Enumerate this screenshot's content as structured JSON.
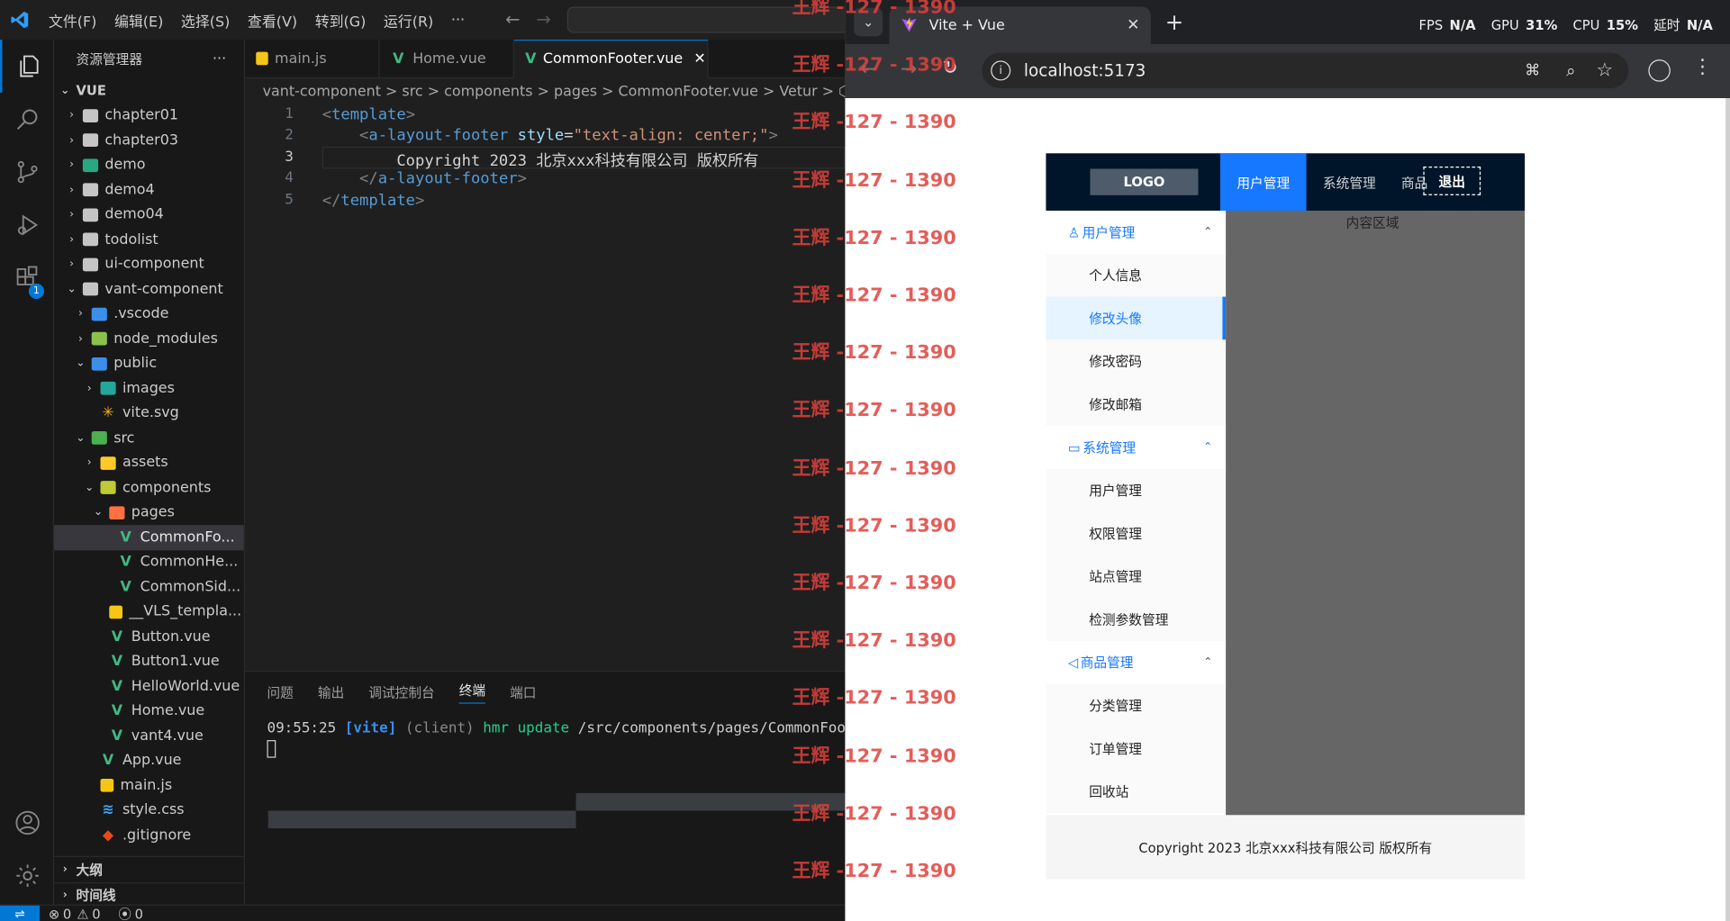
{
  "vscode": {
    "menu": [
      "文件(F)",
      "编辑(E)",
      "选择(S)",
      "查看(V)",
      "转到(G)",
      "运行(R)",
      "···"
    ],
    "explorer_title": "资源管理器",
    "explorer_more": "···",
    "root_label": "VUE",
    "tree": [
      {
        "label": "chapter01",
        "depth": 0,
        "chevron": "›",
        "icon": "folder"
      },
      {
        "label": "chapter03",
        "depth": 0,
        "chevron": "›",
        "icon": "folder"
      },
      {
        "label": "demo",
        "depth": 0,
        "chevron": "›",
        "icon": "folder-demo"
      },
      {
        "label": "demo4",
        "depth": 0,
        "chevron": "›",
        "icon": "folder"
      },
      {
        "label": "demo04",
        "depth": 0,
        "chevron": "›",
        "icon": "folder"
      },
      {
        "label": "todolist",
        "depth": 0,
        "chevron": "›",
        "icon": "folder"
      },
      {
        "label": "ui-component",
        "depth": 0,
        "chevron": "›",
        "icon": "folder"
      },
      {
        "label": "vant-component",
        "depth": 0,
        "chevron": "⌄",
        "icon": "folder-open"
      },
      {
        "label": ".vscode",
        "depth": 1,
        "chevron": "›",
        "icon": "folder-vscode"
      },
      {
        "label": "node_modules",
        "depth": 1,
        "chevron": "›",
        "icon": "folder-node"
      },
      {
        "label": "public",
        "depth": 1,
        "chevron": "⌄",
        "icon": "folder-public"
      },
      {
        "label": "images",
        "depth": 2,
        "chevron": "›",
        "icon": "folder-images"
      },
      {
        "label": "vite.svg",
        "depth": 2,
        "chevron": "",
        "icon": "svg-file"
      },
      {
        "label": "src",
        "depth": 1,
        "chevron": "⌄",
        "icon": "folder-src"
      },
      {
        "label": "assets",
        "depth": 2,
        "chevron": "›",
        "icon": "folder-assets"
      },
      {
        "label": "components",
        "depth": 2,
        "chevron": "⌄",
        "icon": "folder-components"
      },
      {
        "label": "pages",
        "depth": 3,
        "chevron": "⌄",
        "icon": "folder-pages"
      },
      {
        "label": "CommonFo...",
        "depth": 4,
        "chevron": "",
        "icon": "vue-file",
        "selected": true
      },
      {
        "label": "CommonHe...",
        "depth": 4,
        "chevron": "",
        "icon": "vue-file"
      },
      {
        "label": "CommonSid...",
        "depth": 4,
        "chevron": "",
        "icon": "vue-file"
      },
      {
        "label": "__VLS_templa...",
        "depth": 3,
        "chevron": "",
        "icon": "js-file"
      },
      {
        "label": "Button.vue",
        "depth": 3,
        "chevron": "",
        "icon": "vue-file"
      },
      {
        "label": "Button1.vue",
        "depth": 3,
        "chevron": "",
        "icon": "vue-file"
      },
      {
        "label": "HelloWorld.vue",
        "depth": 3,
        "chevron": "",
        "icon": "vue-file"
      },
      {
        "label": "Home.vue",
        "depth": 3,
        "chevron": "",
        "icon": "vue-file"
      },
      {
        "label": "vant4.vue",
        "depth": 3,
        "chevron": "",
        "icon": "vue-file"
      },
      {
        "label": "App.vue",
        "depth": 2,
        "chevron": "",
        "icon": "vue-file"
      },
      {
        "label": "main.js",
        "depth": 2,
        "chevron": "",
        "icon": "js-file"
      },
      {
        "label": "style.css",
        "depth": 2,
        "chevron": "",
        "icon": "css-file"
      },
      {
        "label": ".gitignore",
        "depth": 2,
        "chevron": "",
        "icon": "git-file"
      }
    ],
    "outline_label": "大纲",
    "timeline_label": "时间线",
    "tabs": [
      {
        "label": "main.js",
        "icon": "js-file"
      },
      {
        "label": "Home.vue",
        "icon": "vue-file"
      },
      {
        "label": "CommonFooter.vue",
        "icon": "vue-file",
        "active": true
      }
    ],
    "breadcrumb": "vant-component > src > components > pages > CommonFooter.vue > Vetur > ⬡ tem",
    "code_lines": [
      {
        "n": "1",
        "tokens": [
          {
            "t": "<",
            "c": "#808080"
          },
          {
            "t": "template",
            "c": "#569cd6"
          },
          {
            "t": ">",
            "c": "#808080"
          }
        ]
      },
      {
        "n": "2",
        "tokens": [
          {
            "t": "    ",
            "c": "#ccc"
          },
          {
            "t": "<",
            "c": "#808080"
          },
          {
            "t": "a-layout-footer",
            "c": "#569cd6"
          },
          {
            "t": " style",
            "c": "#9cdcfe"
          },
          {
            "t": "=",
            "c": "#d4d4d4"
          },
          {
            "t": "\"text-align: ",
            "c": "#ce9178"
          },
          {
            "t": "center",
            "c": "#ce9178"
          },
          {
            "t": ";\"",
            "c": "#ce9178"
          },
          {
            "t": ">",
            "c": "#808080"
          }
        ]
      },
      {
        "n": "3",
        "tokens": [
          {
            "t": "        Copyright 2023 北京xxx科技有限公司 版权所有",
            "c": "#d4d4d4"
          }
        ]
      },
      {
        "n": "4",
        "tokens": [
          {
            "t": "    ",
            "c": "#ccc"
          },
          {
            "t": "</",
            "c": "#808080"
          },
          {
            "t": "a-layout-footer",
            "c": "#569cd6"
          },
          {
            "t": ">",
            "c": "#808080"
          }
        ]
      },
      {
        "n": "5",
        "tokens": [
          {
            "t": "</",
            "c": "#808080"
          },
          {
            "t": "template",
            "c": "#569cd6"
          },
          {
            "t": ">",
            "c": "#808080"
          }
        ]
      }
    ],
    "panel_tabs": [
      {
        "label": "问题"
      },
      {
        "label": "输出"
      },
      {
        "label": "调试控制台"
      },
      {
        "label": "终端",
        "active": true
      },
      {
        "label": "端口"
      }
    ],
    "terminal_line": {
      "time": "09:55:25",
      "vite": "[vite]",
      "client": "(client)",
      "hmr": "hmr update",
      "path": "/src/components/pages/CommonFooter."
    },
    "status": {
      "errors": "0",
      "warnings": "0",
      "ports": "0"
    }
  },
  "watermark": "王辉 -127 - 1390",
  "chrome": {
    "tab_title": "Vite + Vue",
    "address": "localhost:5173",
    "stats": [
      {
        "label": "FPS",
        "value": "N/A"
      },
      {
        "label": "GPU",
        "value": "31%"
      },
      {
        "label": "CPU",
        "value": "15%"
      },
      {
        "label": "延时",
        "value": "N/A"
      }
    ]
  },
  "app": {
    "logo": "LOGO",
    "top_nav": [
      {
        "label": "用户管理",
        "active": true
      },
      {
        "label": "系统管理"
      },
      {
        "label": "商品"
      }
    ],
    "logout": "退出",
    "content_label": "内容区域",
    "menus": [
      {
        "title": "用户管理",
        "icon": "user-icon",
        "items": [
          "个人信息",
          "修改头像",
          "修改密码",
          "修改邮箱"
        ],
        "selected": 1
      },
      {
        "title": "系统管理",
        "icon": "laptop-icon",
        "items": [
          "用户管理",
          "权限管理",
          "站点管理",
          "检测参数管理"
        ]
      },
      {
        "title": "商品管理",
        "icon": "notification-icon",
        "items": [
          "分类管理",
          "订单管理",
          "回收站"
        ]
      }
    ],
    "footer": "Copyright 2023 北京xxx科技有限公司 版权所有"
  }
}
